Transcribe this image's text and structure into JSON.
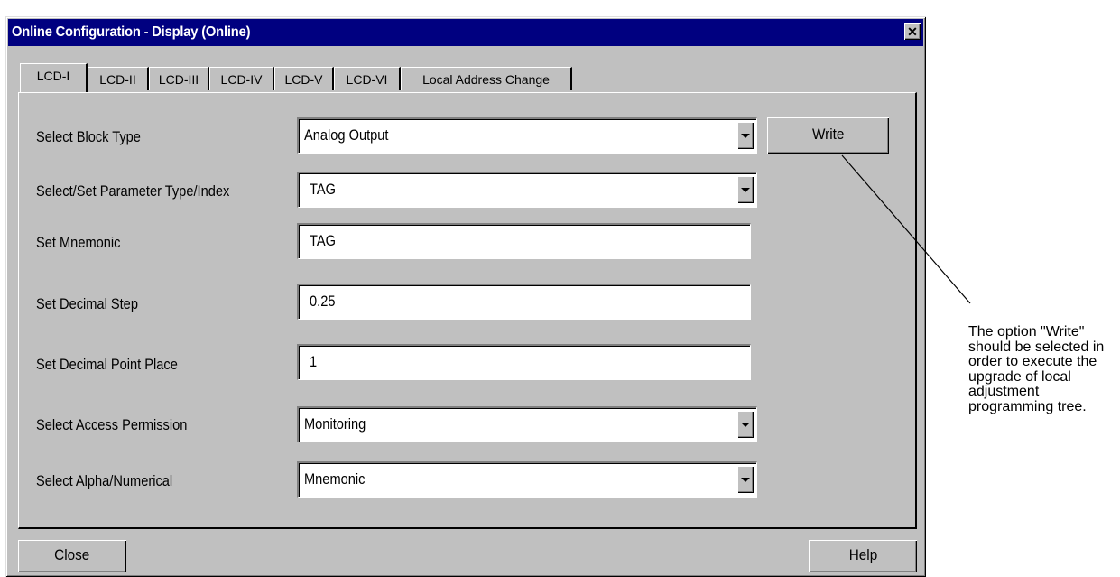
{
  "window": {
    "title": "Online Configuration - Display  (Online)",
    "close_glyph": "✕"
  },
  "tabs": [
    {
      "label": "LCD-I",
      "active": true
    },
    {
      "label": "LCD-II",
      "active": false
    },
    {
      "label": "LCD-III",
      "active": false
    },
    {
      "label": "LCD-IV",
      "active": false
    },
    {
      "label": "LCD-V",
      "active": false
    },
    {
      "label": "LCD-VI",
      "active": false
    },
    {
      "label": "Local Address Change",
      "active": false
    }
  ],
  "form": {
    "block_type": {
      "label": "Select Block Type",
      "value": "Analog Output"
    },
    "parameter": {
      "label": "Select/Set Parameter Type/Index",
      "value": "TAG"
    },
    "mnemonic": {
      "label": "Set Mnemonic",
      "value": "TAG"
    },
    "decimal_step": {
      "label": "Set Decimal Step",
      "value": "0.25"
    },
    "decimal_point": {
      "label": "Set Decimal Point Place",
      "value": "1"
    },
    "access": {
      "label": "Select Access Permission",
      "value": "Monitoring"
    },
    "alpha": {
      "label": "Select Alpha/Numerical",
      "value": "Mnemonic"
    }
  },
  "buttons": {
    "write": "Write",
    "close": "Close",
    "help": "Help"
  },
  "annotation": {
    "text": "The option \"Write\" should be selected in order to execute the upgrade of local adjustment programming tree."
  },
  "colors": {
    "titlebar": "#000080",
    "face": "#c0c0c0"
  }
}
